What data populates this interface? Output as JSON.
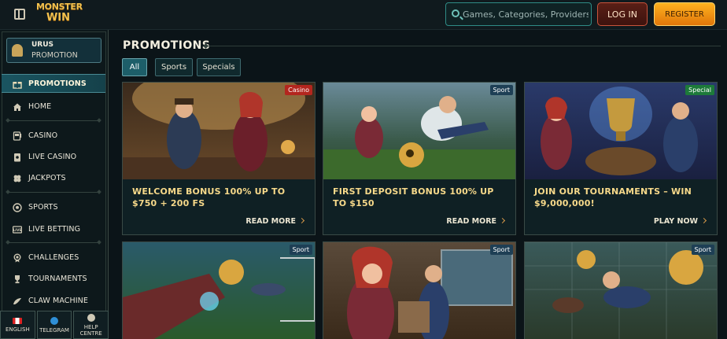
{
  "header": {
    "logo_line1": "MONSTER",
    "logo_line2": "WIN",
    "search_placeholder": "Games, Categories, Providers",
    "login_label": "LOG IN",
    "register_label": "REGISTER"
  },
  "sidebar": {
    "promo_card": {
      "title": "URUS",
      "subtitle": "PROMOTION"
    },
    "items": [
      {
        "label": "PROMOTIONS",
        "icon": "gift-icon"
      },
      {
        "label": "HOME",
        "icon": "home-icon"
      },
      {
        "label": "CASINO",
        "icon": "slot-machine-icon"
      },
      {
        "label": "LIVE CASINO",
        "icon": "cards-icon"
      },
      {
        "label": "JACKPOTS",
        "icon": "clover-icon"
      },
      {
        "label": "SPORTS",
        "icon": "soccer-ball-icon"
      },
      {
        "label": "LIVE BETTING",
        "icon": "live-tv-icon"
      },
      {
        "label": "CHALLENGES",
        "icon": "medal-icon"
      },
      {
        "label": "TOURNAMENTS",
        "icon": "trophy-icon"
      },
      {
        "label": "CLAW MACHINE",
        "icon": "claw-icon"
      }
    ],
    "bottom": [
      {
        "label": "ENGLISH",
        "icon": "canada-flag-icon"
      },
      {
        "label": "TELEGRAM",
        "icon": "telegram-icon"
      },
      {
        "label": "HELP CENTRE",
        "icon": "help-icon"
      }
    ]
  },
  "main": {
    "title": "PROMOTIONS",
    "filters": [
      "All",
      "Sports",
      "Specials"
    ],
    "active_filter": "All",
    "cards": [
      {
        "tag": "Casino",
        "title": "WELCOME BONUS 100% UP TO $750 + 200 FS",
        "cta": "READ MORE",
        "tag_color": "#b3261e"
      },
      {
        "tag": "Sport",
        "title": "FIRST DEPOSIT BONUS 100% UP TO $150",
        "cta": "READ MORE",
        "tag_color": "#1e3f55"
      },
      {
        "tag": "Special",
        "title": "JOIN OUR TOURNAMENTS – WIN $9,000,000!",
        "cta": "PLAY NOW",
        "tag_color": "#1d7a3a"
      },
      {
        "tag": "Sport",
        "tag_color": "#1e3f55"
      },
      {
        "tag": "Sport",
        "tag_color": "#1e3f55"
      },
      {
        "tag": "Sport",
        "tag_color": "#1e3f55"
      }
    ]
  },
  "colors": {
    "accent_gold": "#f7d98a",
    "register_orange": "#ffa31a",
    "login_red": "#5a1f16",
    "active_teal": "#1a5561"
  }
}
